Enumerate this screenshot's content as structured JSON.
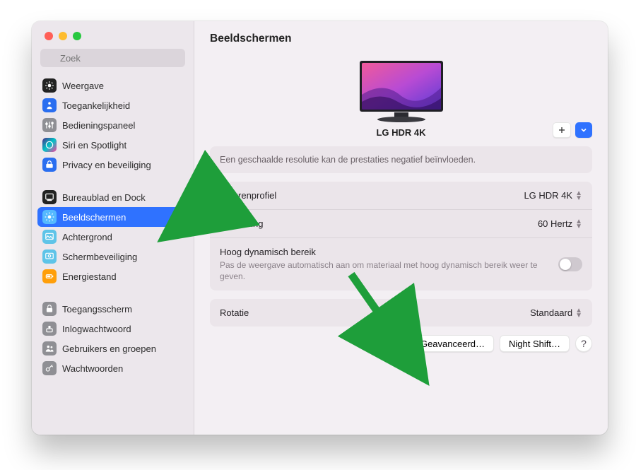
{
  "search": {
    "placeholder": "Zoek"
  },
  "sidebar": {
    "groups": [
      [
        {
          "label": "Weergave",
          "icon": "sun"
        },
        {
          "label": "Toegankelijkheid",
          "icon": "person"
        },
        {
          "label": "Bedieningspaneel",
          "icon": "sliders"
        },
        {
          "label": "Siri en Spotlight",
          "icon": "siri"
        },
        {
          "label": "Privacy en beveiliging",
          "icon": "hand"
        }
      ],
      [
        {
          "label": "Bureaublad en Dock",
          "icon": "dock"
        },
        {
          "label": "Beeldschermen",
          "icon": "brightness",
          "selected": true
        },
        {
          "label": "Achtergrond",
          "icon": "wallpaper"
        },
        {
          "label": "Schermbeveiliging",
          "icon": "screensaver"
        },
        {
          "label": "Energiestand",
          "icon": "battery"
        }
      ],
      [
        {
          "label": "Toegangsscherm",
          "icon": "lock"
        },
        {
          "label": "Inlogwachtwoord",
          "icon": "badge"
        },
        {
          "label": "Gebruikers en groepen",
          "icon": "users"
        },
        {
          "label": "Wachtwoorden",
          "icon": "key"
        }
      ]
    ]
  },
  "main": {
    "title": "Beeldschermen",
    "monitor_name": "LG HDR 4K",
    "resolution_note": "Een geschaalde resolutie kan de prestaties negatief beïnvloeden.",
    "rows": {
      "color_label": "Kleurenprofiel",
      "color_value": "LG HDR 4K",
      "refresh_label": "Verversing",
      "refresh_value": "60 Hertz",
      "hdr_label": "Hoog dynamisch bereik",
      "hdr_sub": "Pas de weergave automatisch aan om materiaal met hoog dynamisch bereik weer te geven.",
      "rotation_label": "Rotatie",
      "rotation_value": "Standaard"
    },
    "footer": {
      "advanced": "Geavanceerd…",
      "nightshift": "Night Shift…",
      "help": "?"
    }
  }
}
